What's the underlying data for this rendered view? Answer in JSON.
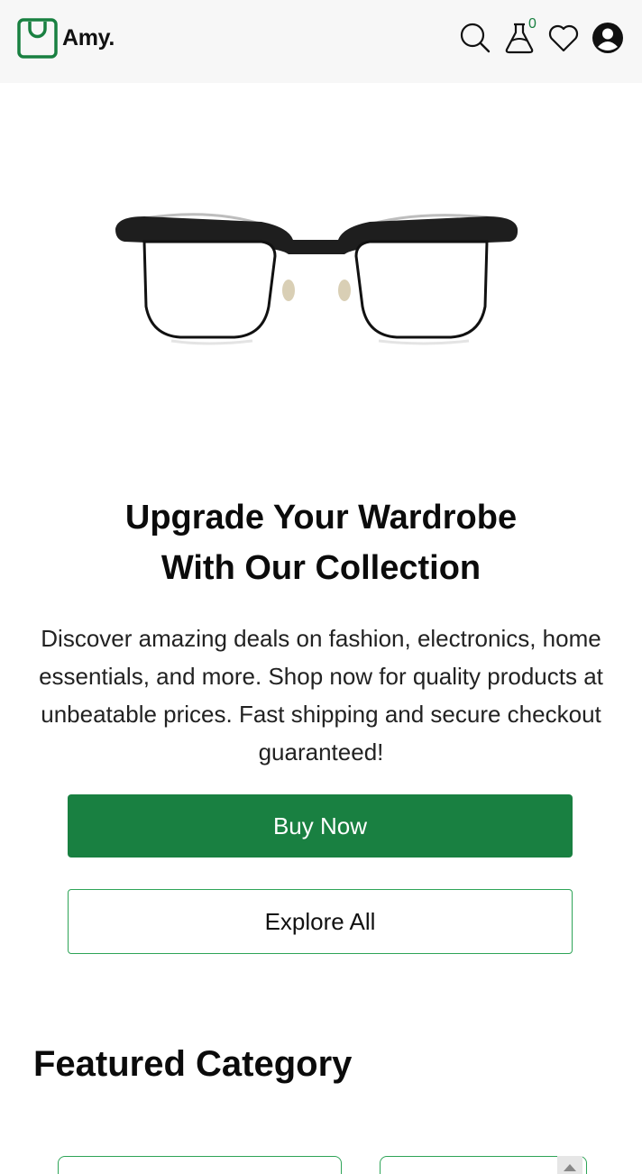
{
  "brand": {
    "name": "Amy.",
    "accent_color": "#198041"
  },
  "header": {
    "icons": [
      "search-icon",
      "cart-icon",
      "heart-icon",
      "account-icon"
    ],
    "cart_count": "0"
  },
  "hero": {
    "image": "eyeglasses",
    "title_line1": "Upgrade Your Wardrobe",
    "title_line2": "With Our Collection",
    "description": "Discover amazing deals on fashion, electronics, home essentials, and more. Shop now for quality products at unbeatable prices. Fast shipping and secure checkout guaranteed!",
    "primary_button": "Buy Now",
    "secondary_button": "Explore All"
  },
  "featured": {
    "title": "Featured Category"
  }
}
